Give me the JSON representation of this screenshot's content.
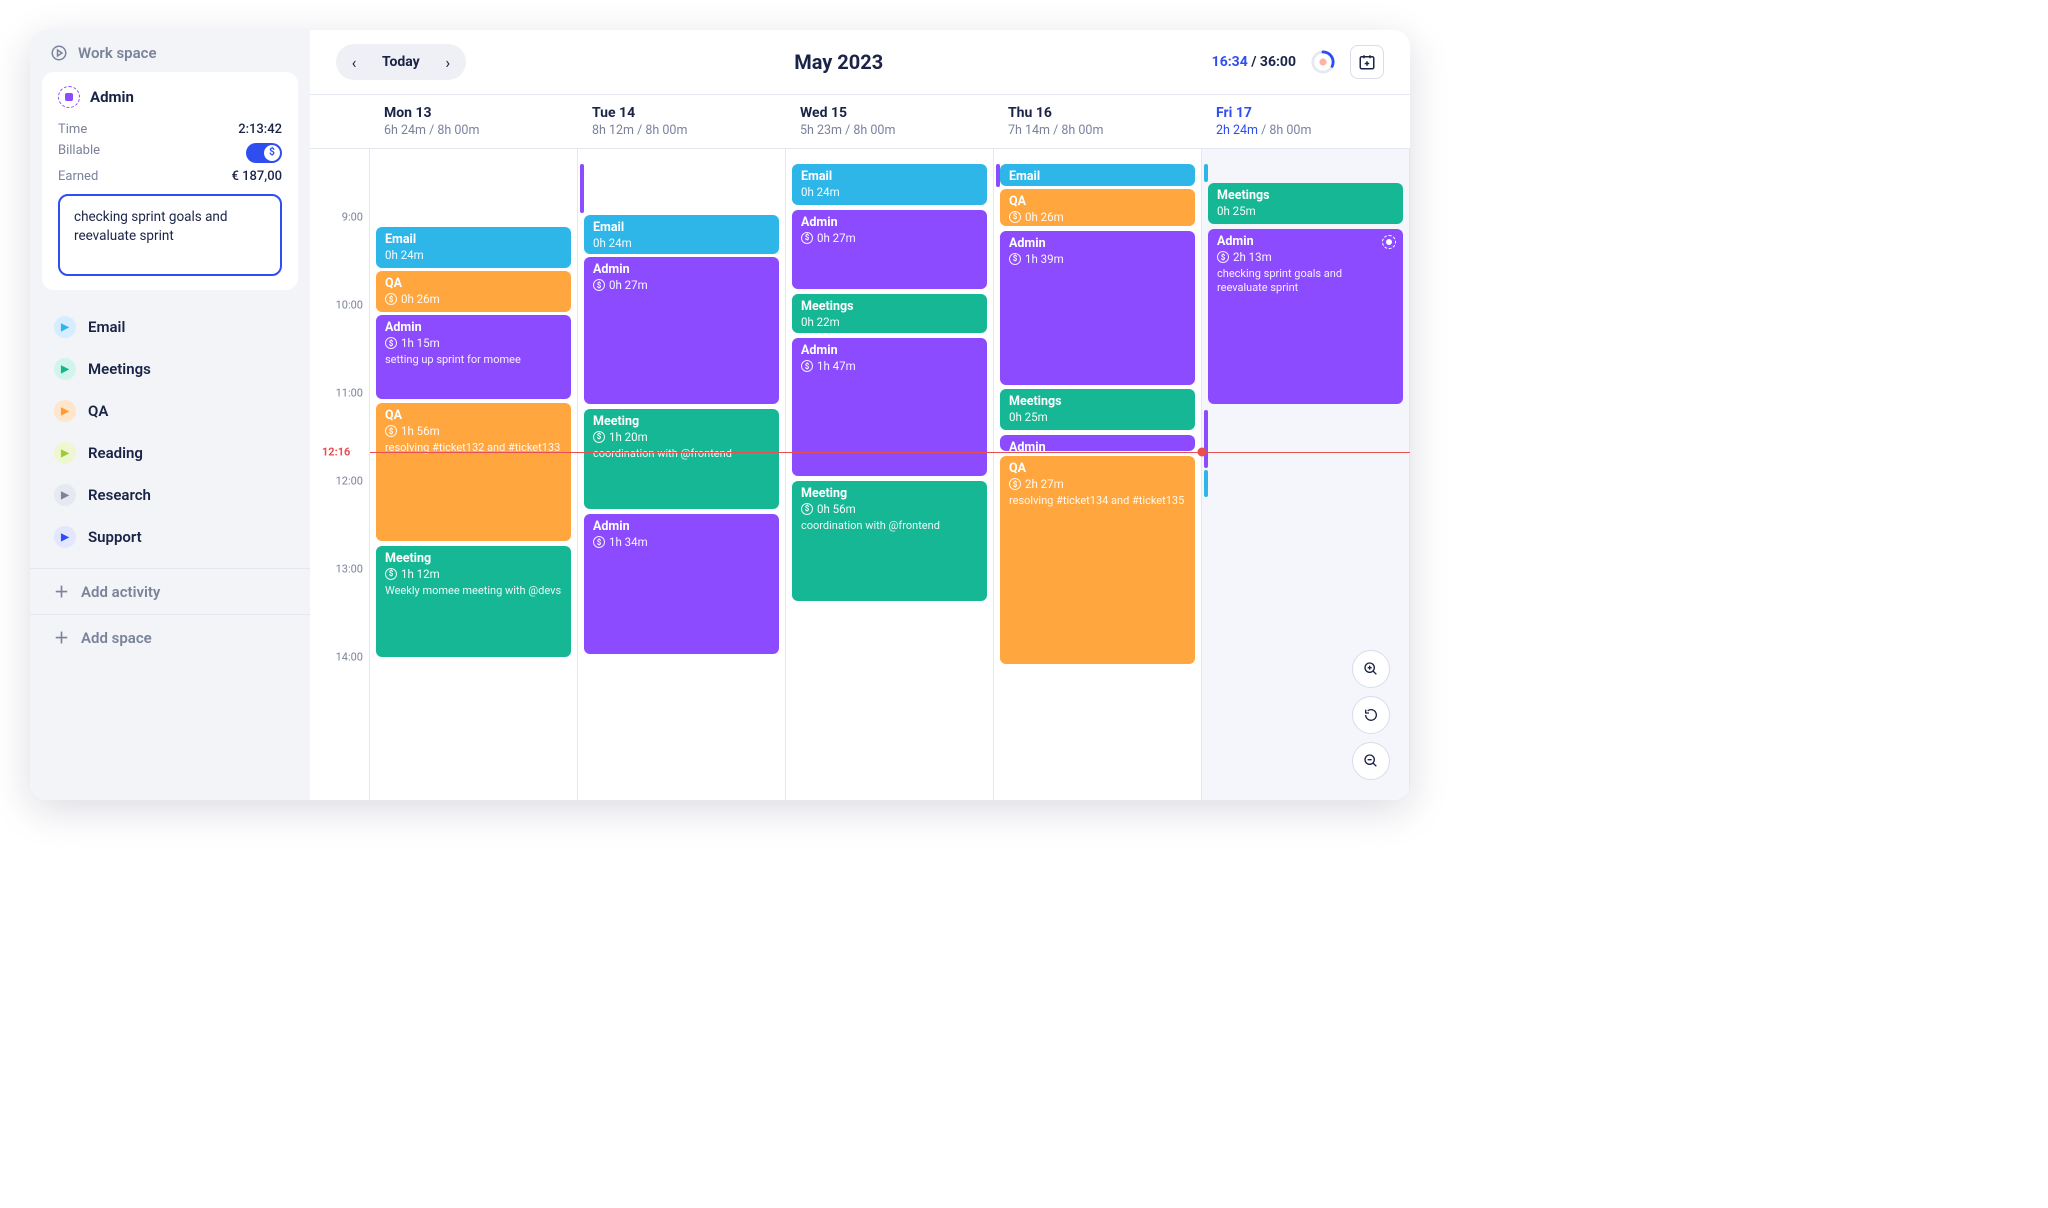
{
  "workspace_label": "Work space",
  "project": {
    "name": "Admin",
    "rows": {
      "time_label": "Time",
      "time_value": "2:13:42",
      "billable_label": "Billable",
      "earned_label": "Earned",
      "earned_value": "€ 187,00"
    },
    "note": "checking sprint goals and reevaluate sprint"
  },
  "spaces": [
    {
      "name": "Email",
      "bg": "#d6ecff",
      "fg": "#2fb6e8"
    },
    {
      "name": "Meetings",
      "bg": "#d2f5eb",
      "fg": "#14b690"
    },
    {
      "name": "QA",
      "bg": "#ffe5c9",
      "fg": "#ff9b36"
    },
    {
      "name": "Reading",
      "bg": "#eef7d1",
      "fg": "#9bcf2f"
    },
    {
      "name": "Research",
      "bg": "#e6e9f0",
      "fg": "#7a839a"
    },
    {
      "name": "Support",
      "bg": "#e2e6ff",
      "fg": "#2f4ef0"
    }
  ],
  "add_activity_label": "Add activity",
  "add_space_label": "Add space",
  "topbar": {
    "today": "Today",
    "month": "May 2023",
    "timer_current": "16:34",
    "timer_total": "36:00"
  },
  "colors": {
    "email": "#2fb6e8",
    "admin": "#8d4bff",
    "qa": "#ffa63e",
    "meetings": "#16b795",
    "meeting": "#16b795"
  },
  "hours": [
    "9:00",
    "10:00",
    "11:00",
    "12:00",
    "13:00",
    "14:00"
  ],
  "current_time_label": "12:16",
  "current_time_slot": 3.27,
  "days": [
    {
      "label": "Mon 13",
      "summary_cur": "6h 24m",
      "summary_tot": "8h 00m",
      "today": false
    },
    {
      "label": "Tue 14",
      "summary_cur": "8h 12m",
      "summary_tot": "8h 00m",
      "today": false
    },
    {
      "label": "Wed 15",
      "summary_cur": "5h 23m",
      "summary_tot": "8h 00m",
      "today": false
    },
    {
      "label": "Thu 16",
      "summary_cur": "7h 14m",
      "summary_tot": "8h 00m",
      "today": false
    },
    {
      "label": "Fri 17",
      "summary_cur": "2h 24m",
      "summary_tot": "8h 00m",
      "today": true
    }
  ],
  "events": {
    "0": [
      {
        "title": "Email",
        "dur": "0h 24m",
        "color": "email",
        "top": 0.72,
        "h": 0.5
      },
      {
        "title": "QA",
        "dur": "0h 26m",
        "color": "qa",
        "bill": true,
        "top": 1.22,
        "h": 0.5
      },
      {
        "title": "Admin",
        "dur": "1h 15m",
        "color": "admin",
        "bill": true,
        "note": "setting up sprint for momee",
        "top": 1.72,
        "h": 0.98
      },
      {
        "title": "QA",
        "dur": "1h 56m",
        "color": "qa",
        "bill": true,
        "note": "resolving #ticket132 and #ticket133",
        "top": 2.72,
        "h": 1.6
      },
      {
        "title": "Meeting",
        "dur": "1h 12m",
        "color": "meeting",
        "bill": true,
        "note": "Weekly momee meeting with @devs",
        "top": 4.34,
        "h": 1.3
      }
    ],
    "1": [
      {
        "title": "Email",
        "dur": "0h 24m",
        "color": "email",
        "top": 0.58,
        "h": 0.48
      },
      {
        "title": "Admin",
        "dur": "0h 27m",
        "color": "admin",
        "bill": true,
        "top": 1.06,
        "h": 1.7
      },
      {
        "title": "Meeting",
        "dur": "1h 20m",
        "color": "meeting",
        "bill": true,
        "note": "coordination with @frontend",
        "top": 2.78,
        "h": 1.18
      },
      {
        "title": "Admin",
        "dur": "1h 34m",
        "color": "admin",
        "bill": true,
        "top": 3.98,
        "h": 1.62
      }
    ],
    "2": [
      {
        "title": "Email",
        "dur": "0h 24m",
        "color": "email",
        "top": 0.0,
        "h": 0.5
      },
      {
        "title": "Admin",
        "dur": "0h 27m",
        "color": "admin",
        "bill": true,
        "top": 0.52,
        "h": 0.94
      },
      {
        "title": "Meetings",
        "dur": "0h 22m",
        "color": "meetings",
        "top": 1.48,
        "h": 0.48
      },
      {
        "title": "Admin",
        "dur": "1h 47m",
        "color": "admin",
        "bill": true,
        "top": 1.98,
        "h": 1.6
      },
      {
        "title": "Meeting",
        "dur": "0h 56m",
        "color": "meeting",
        "bill": true,
        "note": "coordination with @frontend",
        "top": 3.6,
        "h": 1.4
      }
    ],
    "3": [
      {
        "title": "Email",
        "dur": "",
        "color": "email",
        "top": 0.0,
        "h": 0.28
      },
      {
        "title": "QA",
        "dur": "0h 26m",
        "color": "qa",
        "bill": true,
        "top": 0.28,
        "h": 0.46
      },
      {
        "title": "Admin",
        "dur": "1h 39m",
        "color": "admin",
        "bill": true,
        "top": 0.76,
        "h": 1.78
      },
      {
        "title": "Meetings",
        "dur": "0h 25m",
        "color": "meetings",
        "top": 2.56,
        "h": 0.5
      },
      {
        "title": "Admin",
        "dur": "",
        "color": "admin",
        "top": 3.08,
        "h": 0.22
      },
      {
        "title": "QA",
        "dur": "2h 27m",
        "color": "qa",
        "bill": true,
        "note": "resolving #ticket134 and #ticket135",
        "top": 3.32,
        "h": 2.4
      }
    ],
    "4": [
      {
        "title": "Meetings",
        "dur": "0h 25m",
        "color": "meetings",
        "top": 0.22,
        "h": 0.5
      },
      {
        "title": "Admin",
        "dur": "2h 13m",
        "color": "admin",
        "bill": true,
        "note": "checking sprint goals and reevaluate sprint",
        "rec": true,
        "top": 0.74,
        "h": 2.02
      }
    ],
    "strips": {
      "1": [
        {
          "color": "admin",
          "top": 0.0,
          "h": 0.56
        }
      ],
      "3": [
        {
          "color": "admin",
          "top": 0.0,
          "h": 0.26
        }
      ],
      "4": [
        {
          "color": "email",
          "top": 0.0,
          "h": 0.2
        },
        {
          "color": "admin",
          "top": 2.8,
          "h": 0.66
        },
        {
          "color": "email",
          "top": 3.48,
          "h": 0.3
        }
      ]
    }
  }
}
